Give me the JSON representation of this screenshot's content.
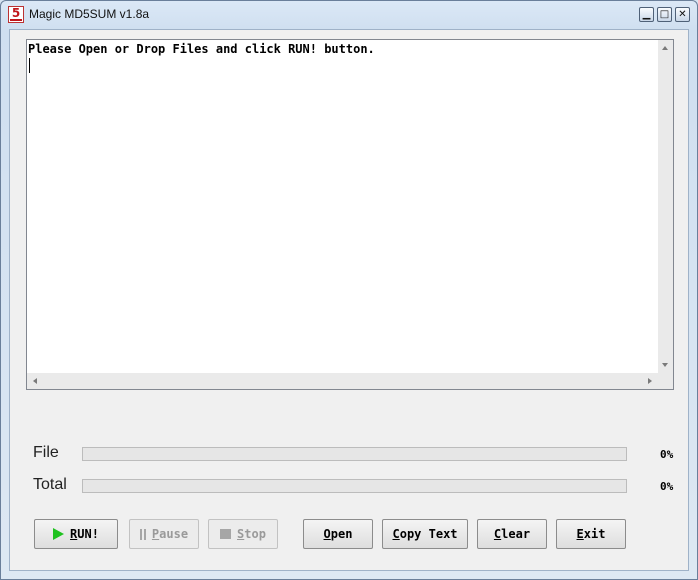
{
  "window": {
    "title": "Magic MD5SUM v1.8a",
    "icon_label": "5",
    "minimize_glyph": "▁",
    "maximize_glyph": "□",
    "close_glyph": "✕"
  },
  "output": {
    "text": "Please Open or Drop Files and click RUN! button."
  },
  "progress": {
    "file_label": "File",
    "file_percent": "0%",
    "file_value": 0,
    "total_label": "Total",
    "total_percent": "0%",
    "total_value": 0
  },
  "buttons": {
    "run": "RUN!",
    "pause": "Pause",
    "stop": "Stop",
    "open": "Open",
    "copy_text": "Copy Text",
    "clear": "Clear",
    "exit": "Exit"
  },
  "icons": {
    "run": "play-icon",
    "pause": "pause-icon",
    "stop": "stop-icon"
  },
  "colors": {
    "run_icon": "#1fc21f",
    "disabled_text": "#9a9a9a"
  }
}
